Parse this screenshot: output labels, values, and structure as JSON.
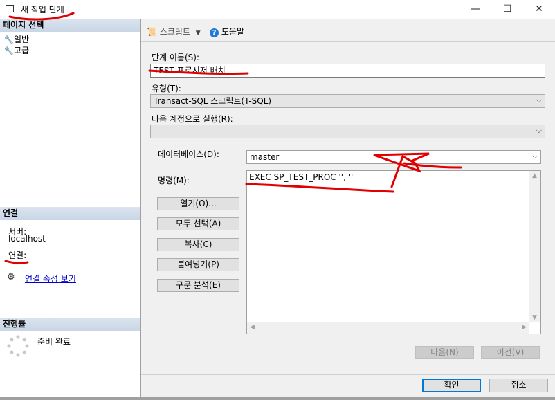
{
  "window": {
    "title": "새 작업 단계",
    "controls": {
      "minimize": "—",
      "maximize": "☐",
      "close": "✕"
    }
  },
  "left": {
    "page_select_header": "페이지 선택",
    "pages": [
      {
        "label": "일반",
        "icon": "wrench-icon"
      },
      {
        "label": "고급",
        "icon": "wrench-icon"
      }
    ],
    "connection_header": "연결",
    "server_label": "서버:",
    "server_value": "localhost",
    "connection_label": "연결:",
    "view_connection_link": "연결 속성 보기",
    "progress_header": "진행률",
    "progress_status": "준비 완료"
  },
  "toolbar": {
    "script_label": "스크립트",
    "help_label": "도움말"
  },
  "form": {
    "step_name_label": "단계 이름(S):",
    "step_name_value": "TEST 프로시저 배치",
    "type_label": "유형(T):",
    "type_value": "Transact-SQL 스크립트(T-SQL)",
    "run_as_label": "다음 계정으로 실행(R):",
    "run_as_value": "",
    "database_label": "데이터베이스(D):",
    "database_value": "master",
    "command_label": "명령(M):",
    "command_value": "EXEC SP_TEST_PROC '', ''",
    "buttons": {
      "open": "열기(O)...",
      "select_all": "모두 선택(A)",
      "copy": "복사(C)",
      "paste": "붙여넣기(P)",
      "parse": "구문 분석(E)"
    },
    "next": "다음(N)",
    "prev": "이전(V)"
  },
  "footer": {
    "ok": "확인",
    "cancel": "취소"
  },
  "colors": {
    "annotation": "#e00000",
    "default_button_border": "#0078d7",
    "section_header": "#c9d6e6"
  }
}
